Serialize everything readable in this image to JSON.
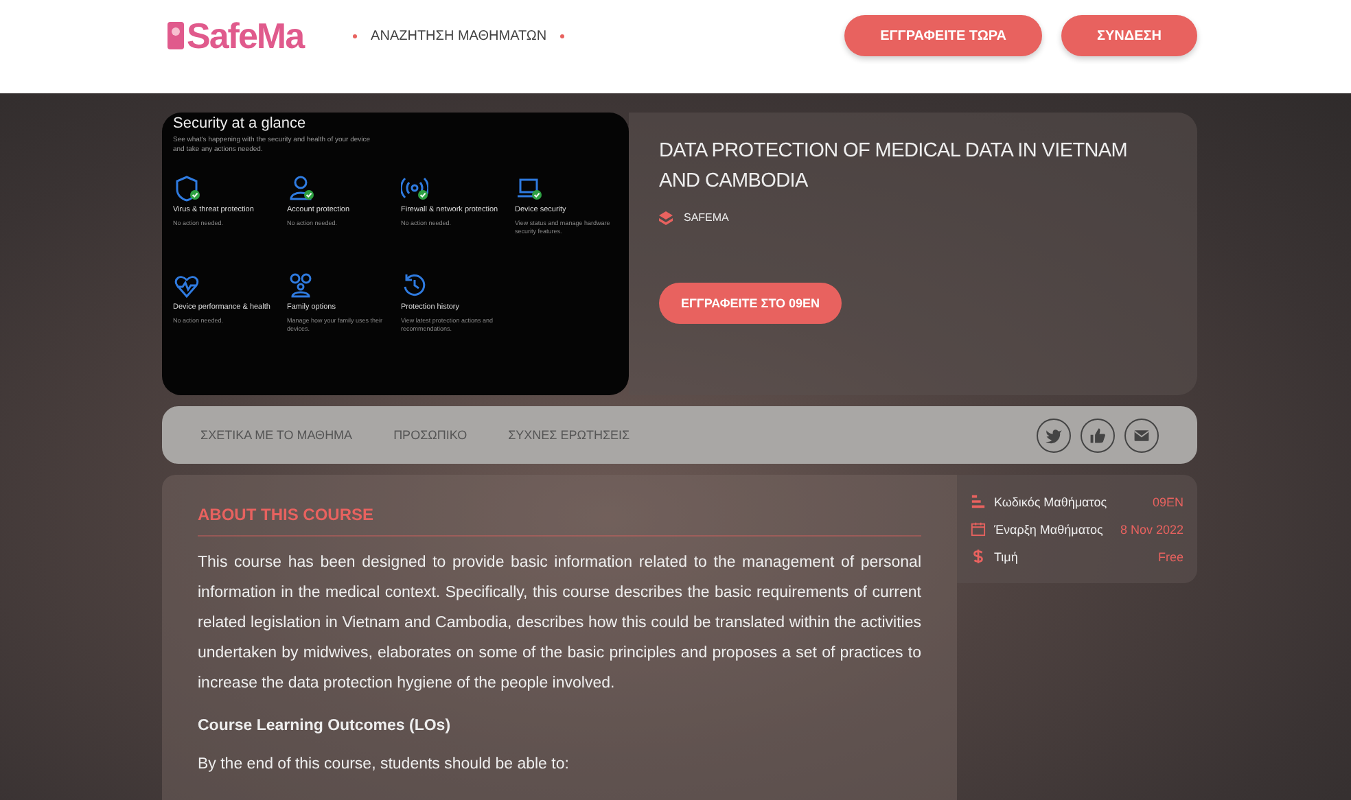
{
  "header": {
    "logo": "SafeMa",
    "nav": [
      {
        "label": "ΑΝΑΖΗΤΗΣΗ ΜΑΘΗΜΑΤΩΝ"
      }
    ],
    "buttons": [
      {
        "label": "ΕΓΓΡΑΦΕΙΤΕ ΤΩΡΑ"
      },
      {
        "label": "ΣΥΝΔΕΣΗ"
      }
    ]
  },
  "course_image": {
    "title": "Security at a glance",
    "subtitle": "See what's happening with the security and health of your device and take any actions needed.",
    "tiles": [
      {
        "kind": "shield",
        "title": "Virus & threat protection",
        "status": "No action needed.",
        "ok": true
      },
      {
        "kind": "person",
        "title": "Account protection",
        "status": "No action needed.",
        "ok": true
      },
      {
        "kind": "wireless",
        "title": "Firewall & network protection",
        "status": "No action needed.",
        "ok": true
      },
      {
        "kind": "laptop",
        "title": "Device security",
        "status": "View status and manage hardware security features.",
        "ok": true
      },
      {
        "kind": "heart",
        "title": "Device performance & health",
        "status": "No action needed.",
        "ok": false
      },
      {
        "kind": "family",
        "title": "Family options",
        "status": "Manage how your family uses their devices.",
        "ok": false
      },
      {
        "kind": "history",
        "title": "Protection history",
        "status": "View latest protection actions and recommendations.",
        "ok": false
      }
    ]
  },
  "course": {
    "title": "DATA PROTECTION OF MEDICAL DATA IN VIETNAM AND CAMBODIA",
    "provider": "SAFEMA",
    "enroll_button": "ΕΓΓΡΑΦΕΙΤΕ ΣΤΟ 09EN"
  },
  "tabs": [
    {
      "label": "ΣΧΕΤΙΚΑ ΜΕ ΤΟ ΜΑΘΗΜΑ"
    },
    {
      "label": "ΠΡΟΣΩΠΙΚΟ"
    },
    {
      "label": "ΣΥΧΝΕΣ ΕΡΩΤΗΣΕΙΣ"
    }
  ],
  "share": [
    {
      "kind": "twitter"
    },
    {
      "kind": "like"
    },
    {
      "kind": "email"
    }
  ],
  "about": {
    "heading": "ABOUT THIS COURSE",
    "body": "This course has been designed to provide basic information related to the management of personal information in the medical context. Specifically, this course describes the basic requirements of current related legislation in Vietnam and Cambodia, describes how this could be translated within the activities undertaken by midwives, elaborates on some of the basic principles and proposes a set of practices to increase the data protection hygiene of the people involved.",
    "subheading": "Course Learning Outcomes (LOs)",
    "intro": "By the end of this course, students should be able to:"
  },
  "details": [
    {
      "kind": "code",
      "label": "Κωδικός Μαθήματος",
      "value": "09EN"
    },
    {
      "kind": "start",
      "label": "Έναρξη Μαθήματος",
      "value": "8 Nov 2022"
    },
    {
      "kind": "price",
      "label": "Τιμή",
      "value": "Free"
    }
  ]
}
